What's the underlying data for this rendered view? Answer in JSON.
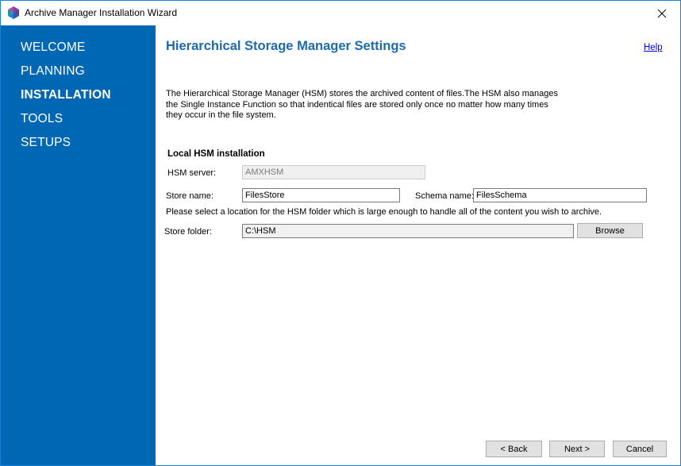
{
  "window": {
    "title": "Archive Manager Installation Wizard",
    "close_icon": "close-icon",
    "app_icon": "archive-manager-logo-icon"
  },
  "sidebar": {
    "items": [
      {
        "label": "WELCOME",
        "active": false
      },
      {
        "label": "PLANNING",
        "active": false
      },
      {
        "label": "INSTALLATION",
        "active": true
      },
      {
        "label": "TOOLS",
        "active": false
      },
      {
        "label": "SETUPS",
        "active": false
      }
    ]
  },
  "main": {
    "title": "Hierarchical Storage Manager Settings",
    "help_label": "Help",
    "description": "The Hierarchical Storage Manager (HSM) stores the archived content of files.The HSM also manages the Single Instance Function so that indentical files are stored only once no matter how many times they occur in the file system.",
    "section_title": "Local HSM installation",
    "hsm_server": {
      "label": "HSM server:",
      "value": "AMXHSM"
    },
    "store_name": {
      "label": "Store name:",
      "value": "FilesStore"
    },
    "schema_name": {
      "label": "Schema name:",
      "value": "FilesSchema"
    },
    "folder_hint": "Please select a location for the HSM folder which is large enough to handle all of the content you wish to archive.",
    "store_folder": {
      "label": "Store folder:",
      "value": "C:\\HSM"
    },
    "browse_label": "Browse"
  },
  "footer": {
    "back_label": "< Back",
    "next_label": "Next >",
    "cancel_label": "Cancel"
  },
  "colors": {
    "sidebar_bg": "#0067b4",
    "title_color": "#1d6aae",
    "window_border": "#1883d7"
  }
}
